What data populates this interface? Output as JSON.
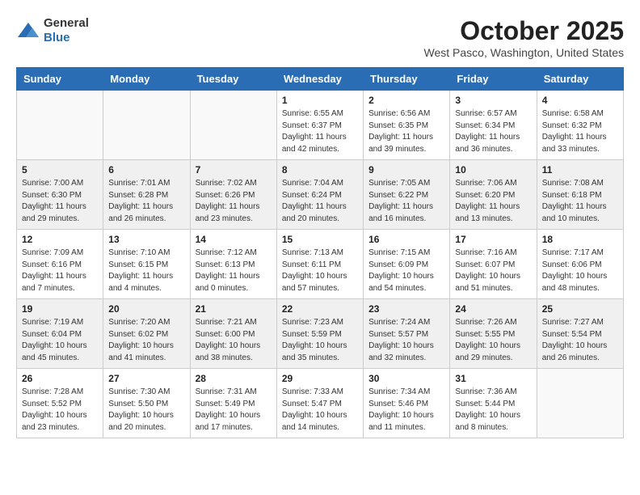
{
  "header": {
    "logo_general": "General",
    "logo_blue": "Blue",
    "month": "October 2025",
    "location": "West Pasco, Washington, United States"
  },
  "days_of_week": [
    "Sunday",
    "Monday",
    "Tuesday",
    "Wednesday",
    "Thursday",
    "Friday",
    "Saturday"
  ],
  "weeks": [
    [
      {
        "day": "",
        "info": ""
      },
      {
        "day": "",
        "info": ""
      },
      {
        "day": "",
        "info": ""
      },
      {
        "day": "1",
        "info": "Sunrise: 6:55 AM\nSunset: 6:37 PM\nDaylight: 11 hours\nand 42 minutes."
      },
      {
        "day": "2",
        "info": "Sunrise: 6:56 AM\nSunset: 6:35 PM\nDaylight: 11 hours\nand 39 minutes."
      },
      {
        "day": "3",
        "info": "Sunrise: 6:57 AM\nSunset: 6:34 PM\nDaylight: 11 hours\nand 36 minutes."
      },
      {
        "day": "4",
        "info": "Sunrise: 6:58 AM\nSunset: 6:32 PM\nDaylight: 11 hours\nand 33 minutes."
      }
    ],
    [
      {
        "day": "5",
        "info": "Sunrise: 7:00 AM\nSunset: 6:30 PM\nDaylight: 11 hours\nand 29 minutes."
      },
      {
        "day": "6",
        "info": "Sunrise: 7:01 AM\nSunset: 6:28 PM\nDaylight: 11 hours\nand 26 minutes."
      },
      {
        "day": "7",
        "info": "Sunrise: 7:02 AM\nSunset: 6:26 PM\nDaylight: 11 hours\nand 23 minutes."
      },
      {
        "day": "8",
        "info": "Sunrise: 7:04 AM\nSunset: 6:24 PM\nDaylight: 11 hours\nand 20 minutes."
      },
      {
        "day": "9",
        "info": "Sunrise: 7:05 AM\nSunset: 6:22 PM\nDaylight: 11 hours\nand 16 minutes."
      },
      {
        "day": "10",
        "info": "Sunrise: 7:06 AM\nSunset: 6:20 PM\nDaylight: 11 hours\nand 13 minutes."
      },
      {
        "day": "11",
        "info": "Sunrise: 7:08 AM\nSunset: 6:18 PM\nDaylight: 11 hours\nand 10 minutes."
      }
    ],
    [
      {
        "day": "12",
        "info": "Sunrise: 7:09 AM\nSunset: 6:16 PM\nDaylight: 11 hours\nand 7 minutes."
      },
      {
        "day": "13",
        "info": "Sunrise: 7:10 AM\nSunset: 6:15 PM\nDaylight: 11 hours\nand 4 minutes."
      },
      {
        "day": "14",
        "info": "Sunrise: 7:12 AM\nSunset: 6:13 PM\nDaylight: 11 hours\nand 0 minutes."
      },
      {
        "day": "15",
        "info": "Sunrise: 7:13 AM\nSunset: 6:11 PM\nDaylight: 10 hours\nand 57 minutes."
      },
      {
        "day": "16",
        "info": "Sunrise: 7:15 AM\nSunset: 6:09 PM\nDaylight: 10 hours\nand 54 minutes."
      },
      {
        "day": "17",
        "info": "Sunrise: 7:16 AM\nSunset: 6:07 PM\nDaylight: 10 hours\nand 51 minutes."
      },
      {
        "day": "18",
        "info": "Sunrise: 7:17 AM\nSunset: 6:06 PM\nDaylight: 10 hours\nand 48 minutes."
      }
    ],
    [
      {
        "day": "19",
        "info": "Sunrise: 7:19 AM\nSunset: 6:04 PM\nDaylight: 10 hours\nand 45 minutes."
      },
      {
        "day": "20",
        "info": "Sunrise: 7:20 AM\nSunset: 6:02 PM\nDaylight: 10 hours\nand 41 minutes."
      },
      {
        "day": "21",
        "info": "Sunrise: 7:21 AM\nSunset: 6:00 PM\nDaylight: 10 hours\nand 38 minutes."
      },
      {
        "day": "22",
        "info": "Sunrise: 7:23 AM\nSunset: 5:59 PM\nDaylight: 10 hours\nand 35 minutes."
      },
      {
        "day": "23",
        "info": "Sunrise: 7:24 AM\nSunset: 5:57 PM\nDaylight: 10 hours\nand 32 minutes."
      },
      {
        "day": "24",
        "info": "Sunrise: 7:26 AM\nSunset: 5:55 PM\nDaylight: 10 hours\nand 29 minutes."
      },
      {
        "day": "25",
        "info": "Sunrise: 7:27 AM\nSunset: 5:54 PM\nDaylight: 10 hours\nand 26 minutes."
      }
    ],
    [
      {
        "day": "26",
        "info": "Sunrise: 7:28 AM\nSunset: 5:52 PM\nDaylight: 10 hours\nand 23 minutes."
      },
      {
        "day": "27",
        "info": "Sunrise: 7:30 AM\nSunset: 5:50 PM\nDaylight: 10 hours\nand 20 minutes."
      },
      {
        "day": "28",
        "info": "Sunrise: 7:31 AM\nSunset: 5:49 PM\nDaylight: 10 hours\nand 17 minutes."
      },
      {
        "day": "29",
        "info": "Sunrise: 7:33 AM\nSunset: 5:47 PM\nDaylight: 10 hours\nand 14 minutes."
      },
      {
        "day": "30",
        "info": "Sunrise: 7:34 AM\nSunset: 5:46 PM\nDaylight: 10 hours\nand 11 minutes."
      },
      {
        "day": "31",
        "info": "Sunrise: 7:36 AM\nSunset: 5:44 PM\nDaylight: 10 hours\nand 8 minutes."
      },
      {
        "day": "",
        "info": ""
      }
    ]
  ]
}
